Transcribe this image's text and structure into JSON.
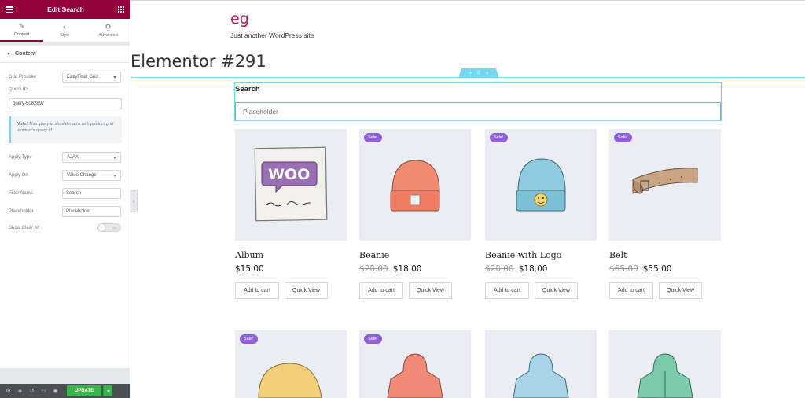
{
  "panel": {
    "title": "Edit Search",
    "tabs": [
      {
        "label": "Content",
        "icon": "pencil-icon"
      },
      {
        "label": "Style",
        "icon": "half-circle-icon"
      },
      {
        "label": "Advanced",
        "icon": "gear-icon"
      }
    ],
    "section_title": "Content",
    "controls": {
      "grid_provider_label": "Grid Provider",
      "grid_provider_value": "EazyFilter Grid",
      "query_id_label": "Query ID",
      "query_id_value": "query-5082897",
      "note_bold": "Note!",
      "note_text": " This query id should match with product grid provider's query id.",
      "apply_type_label": "Apply Type",
      "apply_type_value": "AJAX",
      "apply_on_label": "Apply On",
      "apply_on_value": "Value Change",
      "filter_name_label": "Filter Name",
      "filter_name_value": "Search",
      "placeholder_label": "Placeholder",
      "placeholder_value": "Placeholder",
      "show_clear_all_label": "Show Clear All",
      "show_clear_all_state": "NO"
    },
    "footer": {
      "update_label": "UPDATE"
    }
  },
  "site": {
    "title": "eg",
    "tagline": "Just another WordPress site",
    "page_title": "Elementor #291"
  },
  "search_widget": {
    "label": "Search",
    "placeholder": "Placeholder"
  },
  "products": [
    {
      "name": "Album",
      "price": "$15.00",
      "old_price": "",
      "sale": false,
      "sale_label": "",
      "add_to_cart": "Add to cart",
      "quick_view": "Quick View"
    },
    {
      "name": "Beanie",
      "price": "$18.00",
      "old_price": "$20.00",
      "sale": true,
      "sale_label": "Sale!",
      "add_to_cart": "Add to cart",
      "quick_view": "Quick View"
    },
    {
      "name": "Beanie with Logo",
      "price": "$18.00",
      "old_price": "$20.00",
      "sale": true,
      "sale_label": "Sale!",
      "add_to_cart": "Add to cart",
      "quick_view": "Quick View"
    },
    {
      "name": "Belt",
      "price": "$55.00",
      "old_price": "$65.00",
      "sale": true,
      "sale_label": "Sale!",
      "add_to_cart": "Add to cart",
      "quick_view": "Quick View"
    }
  ],
  "products_row2": [
    {
      "sale": true,
      "sale_label": "Sale!"
    },
    {
      "sale": true,
      "sale_label": "Sale!"
    },
    {
      "sale": false,
      "sale_label": ""
    },
    {
      "sale": false,
      "sale_label": ""
    }
  ],
  "colors": {
    "panel_header": "#93003c",
    "accent_cyan": "#71d7f7",
    "sale_badge": "#8f5fd8",
    "update_button": "#39b54a",
    "site_title": "#c2185b"
  }
}
